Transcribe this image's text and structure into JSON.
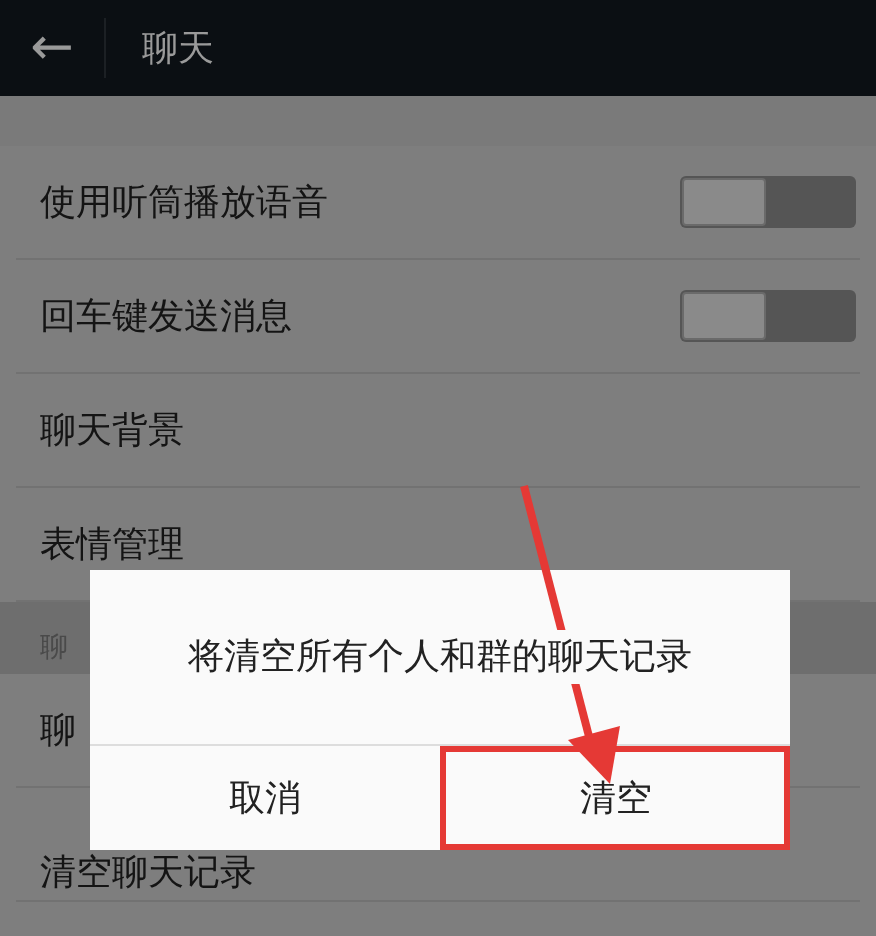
{
  "top_bar": {
    "back": "←",
    "title": "聊天"
  },
  "settings": [
    {
      "kind": "toggle",
      "label": "使用听筒播放语音",
      "on": false
    },
    {
      "kind": "toggle",
      "label": "回车键发送消息",
      "on": false
    },
    {
      "kind": "link",
      "label": "聊天背景"
    },
    {
      "kind": "link",
      "label": "表情管理"
    },
    {
      "kind": "header",
      "label": "聊"
    },
    {
      "kind": "link",
      "label": "聊"
    },
    {
      "kind": "link",
      "label": "清空聊天记录"
    }
  ],
  "dialog": {
    "message": "将清空所有个人和群的聊天记录",
    "buttons": [
      {
        "label": "取消",
        "highlighted": false
      },
      {
        "label": "清空",
        "highlighted": true
      }
    ]
  },
  "annotation": {
    "arrow": true
  }
}
